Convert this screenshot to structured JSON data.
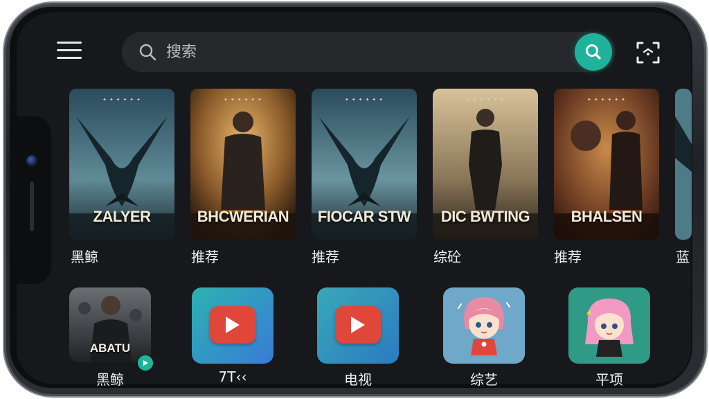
{
  "search": {
    "placeholder": "搜索"
  },
  "posters": [
    {
      "title": "ZALYER",
      "caption": "黑鲸"
    },
    {
      "title": "BHCWERIAN",
      "caption": "推荐"
    },
    {
      "title": "FIOCAR STW",
      "caption": "推荐"
    },
    {
      "title": "DIC BWTING",
      "caption": "综砼"
    },
    {
      "title": "BHALSEN",
      "caption": "推荐"
    },
    {
      "title": "",
      "caption": "蓝"
    }
  ],
  "apps": [
    {
      "title": "ABATU",
      "label": "黑鲸"
    },
    {
      "label": "7T‹‹"
    },
    {
      "label": "电视"
    },
    {
      "label": "综艺"
    },
    {
      "label": "平项"
    }
  ],
  "colors": {
    "accent": "#1fb39b",
    "background": "#17181b",
    "search_bar": "#26282c",
    "play_red": "#e0473a"
  },
  "icons": {
    "menu": "hamburger-menu-icon",
    "search": "search-icon",
    "search_go": "search-icon",
    "scan": "scan-icon",
    "play": "play-icon"
  }
}
